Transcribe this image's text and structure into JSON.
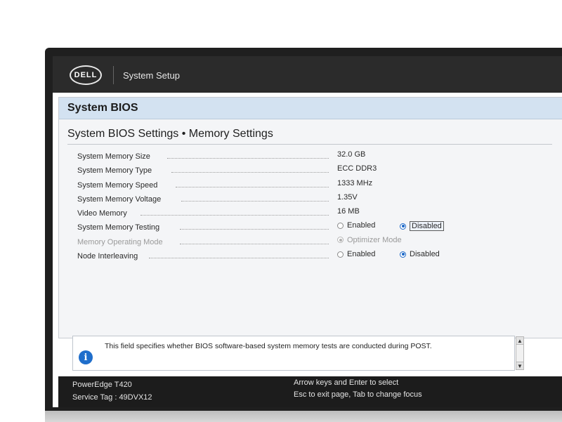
{
  "header": {
    "logo_text": "DELL",
    "title": "System Setup"
  },
  "section": {
    "title": "System BIOS"
  },
  "page": {
    "title": "System BIOS Settings • Memory Settings"
  },
  "settings": [
    {
      "label": "System Memory Size",
      "value": "32.0 GB"
    },
    {
      "label": "System Memory Type",
      "value": "ECC DDR3"
    },
    {
      "label": "System Memory Speed",
      "value": "1333 MHz"
    },
    {
      "label": "System Memory Voltage",
      "value": "1.35V"
    },
    {
      "label": "Video Memory",
      "value": "16 MB"
    },
    {
      "label": "System Memory Testing",
      "options": [
        "Enabled",
        "Disabled"
      ],
      "selected": "Disabled"
    },
    {
      "label": "Memory Operating Mode",
      "options": [
        "Optimizer Mode"
      ],
      "selected": "Optimizer Mode",
      "disabled": true
    },
    {
      "label": "Node Interleaving",
      "options": [
        "Enabled",
        "Disabled"
      ],
      "selected": "Disabled"
    }
  ],
  "help": {
    "text": "This field specifies whether BIOS software-based system memory tests are conducted during POST.",
    "icon": "info-icon"
  },
  "footer": {
    "model": "PowerEdge T420",
    "service_tag": "Service Tag : 49DVX12",
    "help_line1": "Arrow keys and Enter to select",
    "help_line2": "Esc to exit page, Tab to change focus"
  },
  "colors": {
    "topbar": "#2b2b2b",
    "section_bar": "#d3e2f1",
    "accent": "#1b67c7",
    "footer": "#1c1c1c"
  }
}
